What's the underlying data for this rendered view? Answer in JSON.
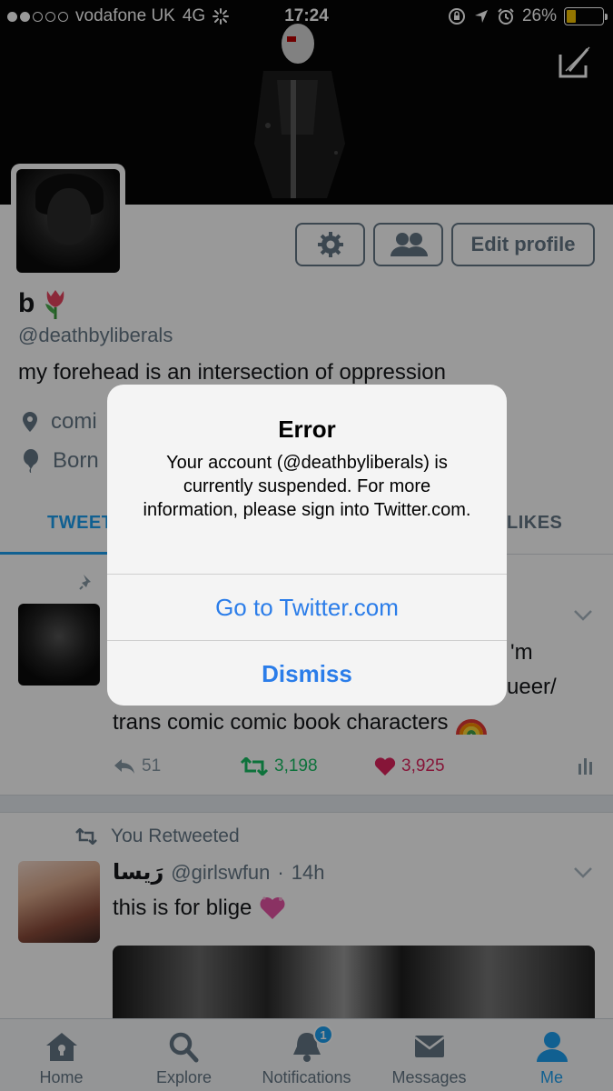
{
  "status_bar": {
    "carrier": "vodafone UK",
    "network": "4G",
    "time": "17:24",
    "battery": "26%",
    "battery_level": 0.26
  },
  "profile": {
    "name": "b",
    "handle": "@deathbyliberals",
    "bio": "my forehead is an intersection of oppression",
    "location_partial": "comi",
    "born_partial": "Born",
    "edit_profile_label": "Edit profile"
  },
  "tabs": {
    "tweets": "TWEET",
    "likes": "LIKES"
  },
  "pinned_tweet": {
    "line1_end": "'m",
    "line2_end": "ueer/",
    "line3": "trans comic comic book characters",
    "replies": "51",
    "retweets": "3,198",
    "likes": "3,925"
  },
  "retweet": {
    "label": "You Retweeted",
    "author_name": "رَيسا",
    "author_handle": "@girlswfun",
    "time": "14h",
    "text": "this is for blige"
  },
  "tab_bar": {
    "home": "Home",
    "explore": "Explore",
    "notifications": "Notifications",
    "notifications_badge": "1",
    "messages": "Messages",
    "me": "Me"
  },
  "alert": {
    "title": "Error",
    "message": "Your account (@deathbyliberals) is currently suspended. For more information, please sign into Twitter.com.",
    "primary_button": "Go to Twitter.com",
    "dismiss_button": "Dismiss"
  },
  "colors": {
    "accent": "#1da1f2",
    "retweet": "#17bf63",
    "like": "#e0245e",
    "alert_button": "#2b7de9"
  }
}
